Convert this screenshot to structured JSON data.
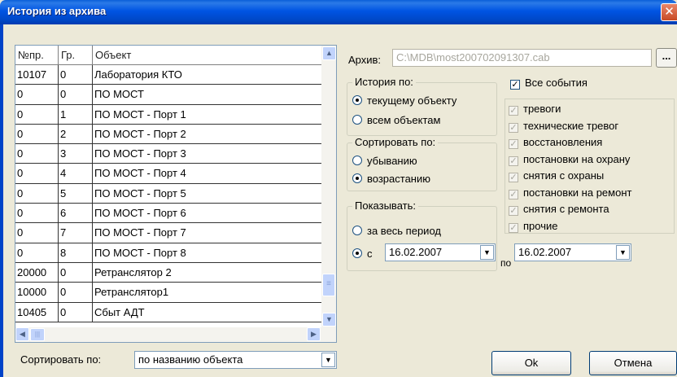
{
  "window": {
    "title": "История из архива",
    "close_glyph": "✕"
  },
  "list": {
    "columns": [
      "№пр.",
      "Гр.",
      "Объект"
    ],
    "rows": [
      [
        "10107",
        "0",
        "Лаборатория КТО"
      ],
      [
        "0",
        "0",
        "ПО МОСТ"
      ],
      [
        "0",
        "1",
        "ПО МОСТ - Порт 1"
      ],
      [
        "0",
        "2",
        "ПО МОСТ - Порт 2"
      ],
      [
        "0",
        "3",
        "ПО МОСТ - Порт 3"
      ],
      [
        "0",
        "4",
        "ПО МОСТ - Порт 4"
      ],
      [
        "0",
        "5",
        "ПО МОСТ - Порт 5"
      ],
      [
        "0",
        "6",
        "ПО МОСТ - Порт 6"
      ],
      [
        "0",
        "7",
        "ПО МОСТ - Порт 7"
      ],
      [
        "0",
        "8",
        "ПО МОСТ - Порт 8"
      ],
      [
        "20000",
        "0",
        "Ретранслятор 2"
      ],
      [
        "10000",
        "0",
        "Ретранслятор1"
      ],
      [
        "10405",
        "0",
        "Сбыт АДТ"
      ]
    ]
  },
  "sort_bottom": {
    "label": "Сортировать по:",
    "value": "по названию объекта"
  },
  "archive": {
    "label": "Архив:",
    "path": "C:\\MDB\\most200702091307.cab",
    "browse_label": "..."
  },
  "history_by": {
    "title": "История по:",
    "options": [
      "текущему объекту",
      "всем объектам"
    ],
    "selected": 0
  },
  "sort_by": {
    "title": "Сортировать по:",
    "options": [
      "убыванию",
      "возрастанию"
    ],
    "selected": 1
  },
  "show": {
    "title": "Показывать:",
    "option_all": "за весь период",
    "option_from": "с",
    "from_date": "16.02.2007",
    "to_label": "по",
    "to_date": "16.02.2007",
    "selected": 1
  },
  "events": {
    "all_label": "Все события",
    "all_checked": true,
    "items": [
      "тревоги",
      "технические тревог",
      "восстановления",
      "постановки на охрану",
      "снятия с охраны",
      "постановки на ремонт",
      "снятия с ремонта",
      "прочие"
    ]
  },
  "buttons": {
    "ok": "Ok",
    "cancel": "Отмена"
  }
}
